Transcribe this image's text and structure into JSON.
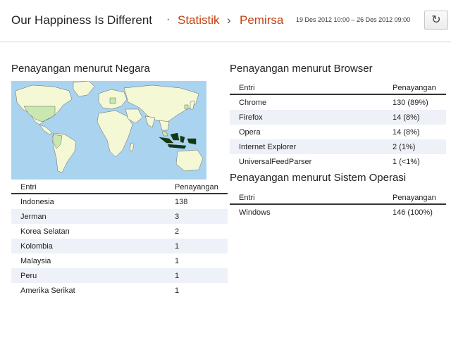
{
  "header": {
    "blog_title": "Our Happiness Is Different",
    "separator": "·",
    "crumb_stat": "Statistik",
    "crumb_arrow": "›",
    "crumb_pem": "Pemirsa",
    "date_range": "19 Des 2012 10:00 – 26 Des 2012 09:00",
    "refresh_icon": "refresh-icon",
    "refresh_glyph": "↻"
  },
  "country": {
    "title": "Penayangan menurut Negara",
    "col_entry": "Entri",
    "col_views": "Penayangan",
    "rows": [
      {
        "name": "Indonesia",
        "views": "138"
      },
      {
        "name": "Jerman",
        "views": "3"
      },
      {
        "name": "Korea Selatan",
        "views": "2"
      },
      {
        "name": "Kolombia",
        "views": "1"
      },
      {
        "name": "Malaysia",
        "views": "1"
      },
      {
        "name": "Peru",
        "views": "1"
      },
      {
        "name": "Amerika Serikat",
        "views": "1"
      }
    ]
  },
  "browser": {
    "title": "Penayangan menurut Browser",
    "col_entry": "Entri",
    "col_views": "Penayangan",
    "rows": [
      {
        "name": "Chrome",
        "views": "130 (89%)"
      },
      {
        "name": "Firefox",
        "views": "14 (8%)"
      },
      {
        "name": "Opera",
        "views": "14 (8%)"
      },
      {
        "name": "Internet Explorer",
        "views": "2 (1%)"
      },
      {
        "name": "UniversalFeedParser",
        "views": "1 (<1%)"
      }
    ]
  },
  "os": {
    "title": "Penayangan menurut Sistem Operasi",
    "col_entry": "Entri",
    "col_views": "Penayangan",
    "rows": [
      {
        "name": "Windows",
        "views": "146 (100%)"
      }
    ]
  },
  "colors": {
    "accent": "#c4400e",
    "ocean": "#aad3f0",
    "land": "#f5f8d4",
    "highlight_light": "#c8e8b0",
    "highlight_dark": "#0d3d0d"
  }
}
